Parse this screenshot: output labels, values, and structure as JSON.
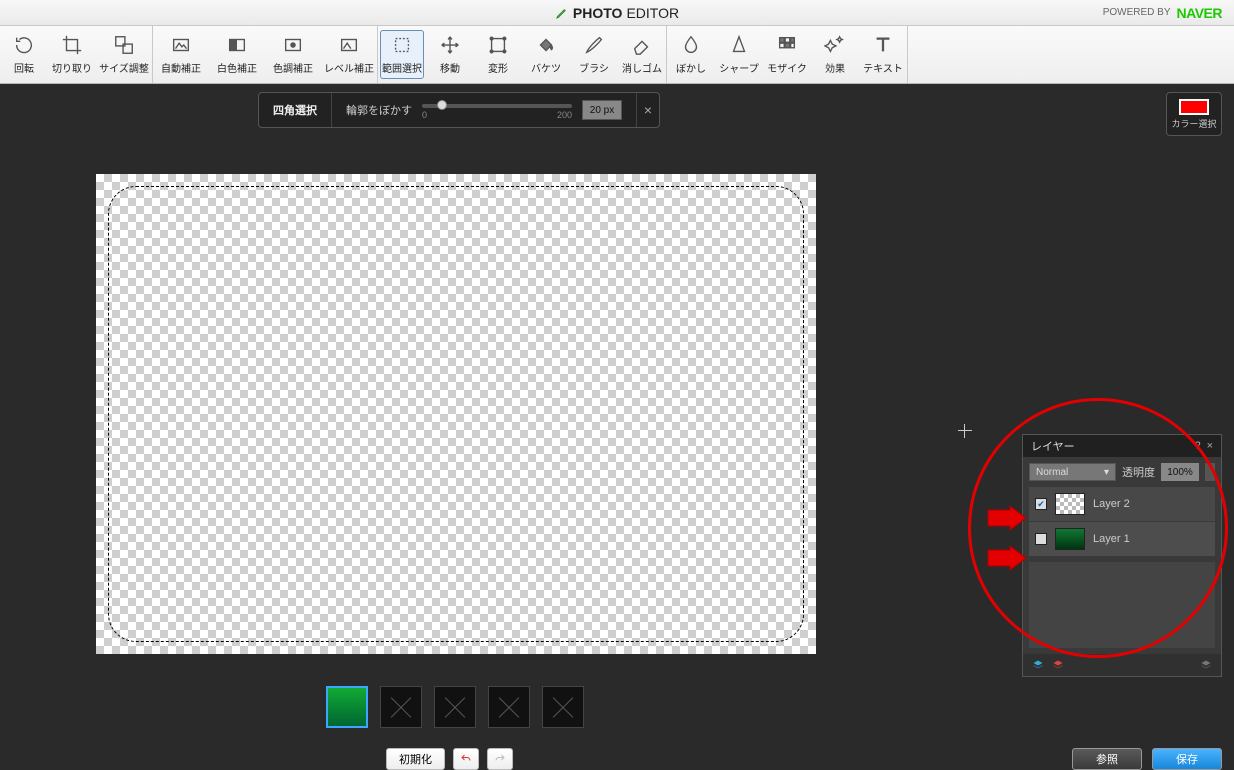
{
  "header": {
    "app_name_bold": "PHOTO",
    "app_name_thin": "EDITOR",
    "powered_by_label": "POWERED BY",
    "powered_by_brand": "NAVER"
  },
  "toolbar": {
    "rotate": "回転",
    "crop": "切り取り",
    "resize": "サイズ調整",
    "auto_correct": "自動補正",
    "white_balance": "白色補正",
    "color_correct": "色調補正",
    "level_correct": "レベル補正",
    "select_range": "範囲選択",
    "move": "移動",
    "transform": "変形",
    "bucket": "バケツ",
    "brush": "ブラシ",
    "eraser": "消しゴム",
    "blur": "ぼかし",
    "sharpen": "シャープ",
    "mosaic": "モザイク",
    "effect": "効果",
    "text": "テキスト"
  },
  "tool_opts": {
    "mode_label": "四角選択",
    "feather_label": "輪郭をぼかす",
    "slider_min": "0",
    "slider_max": "200",
    "value": "20 px"
  },
  "color_panel": {
    "label": "カラー選択",
    "swatch": "#ff0000"
  },
  "layers_panel": {
    "title": "レイヤー",
    "blend_mode": "Normal",
    "opacity_label": "透明度",
    "opacity_value": "100%",
    "items": [
      {
        "visible": true,
        "name": "Layer 2",
        "thumb": "checker"
      },
      {
        "visible": false,
        "name": "Layer 1",
        "thumb": "image"
      }
    ]
  },
  "bottom": {
    "reset": "初期化",
    "browse": "参照",
    "save": "保存"
  }
}
